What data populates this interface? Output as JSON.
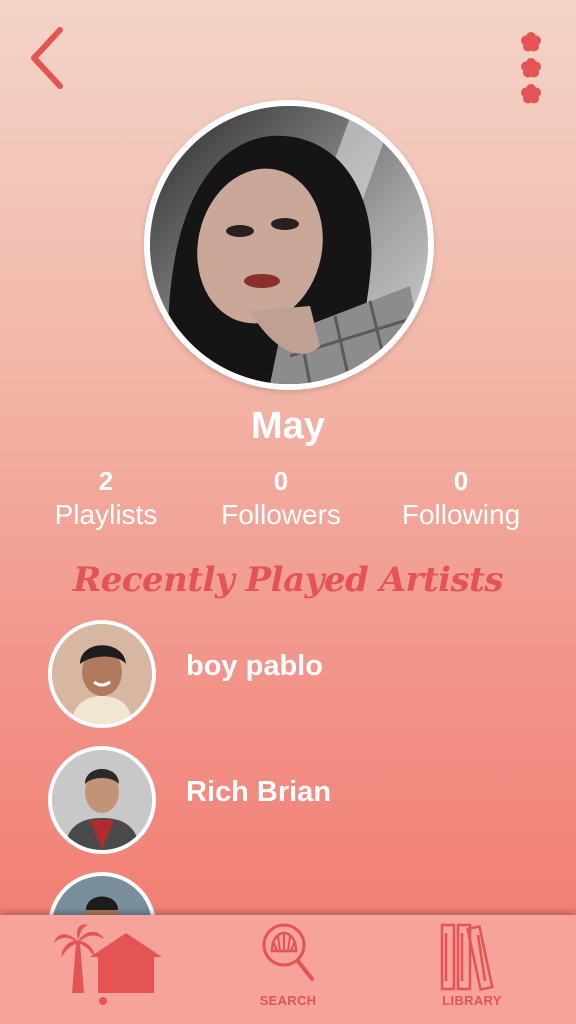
{
  "header": {
    "back_icon": "chevron-left-icon",
    "more_icon": "flower-dots-icon",
    "accent": "#e45454"
  },
  "profile": {
    "name": "May",
    "stats": [
      {
        "value": "2",
        "label": "Playlists"
      },
      {
        "value": "0",
        "label": "Followers"
      },
      {
        "value": "0",
        "label": "Following"
      }
    ]
  },
  "recent": {
    "title": "Recently Played Artists",
    "artists": [
      {
        "name": "boy pablo"
      },
      {
        "name": "Rich Brian"
      }
    ]
  },
  "tabbar": {
    "home_icon": "palm-house-icon",
    "search_label": "SEARCH",
    "library_label": "LIBRARY",
    "active": "home"
  }
}
